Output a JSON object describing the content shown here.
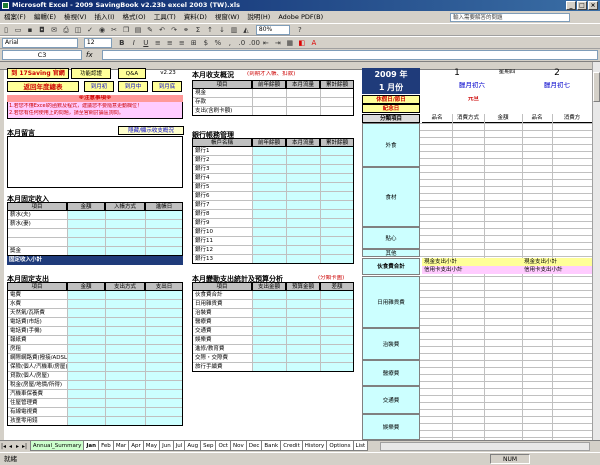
{
  "window": {
    "title": "Microsoft Excel - 2009 SavingBook v2.23b excel 2003 (TW).xls",
    "min": "_",
    "max": "□",
    "close": "×"
  },
  "menu": {
    "items": [
      "檔案(F)",
      "編輯(E)",
      "檢視(V)",
      "插入(I)",
      "格式(O)",
      "工具(T)",
      "資料(D)",
      "視窗(W)",
      "說明(H)",
      "Adobe PDF(B)"
    ],
    "help_placeholder": "輸入需要解答的問題"
  },
  "toolbar": {
    "font_name": "Arial",
    "font_size": "12",
    "zoom": "80%"
  },
  "formula": {
    "name_box": "C3",
    "fx": "fx",
    "value": ""
  },
  "sheet": {
    "left": {
      "btn_title": "到 17Saving 官網",
      "btn_fund": "功能認證",
      "btn_qa": "Q&A",
      "version": "v2.23",
      "btn_return": "返回年度總表",
      "btn_prev": "到月初",
      "btn_mid": "到月中",
      "btn_end": "到月底",
      "notice_title": "※注意事項※",
      "notice_1": "1.若您不懂Excel的函數及程式，建議您不要隨意更動欄位！",
      "notice_2": "2.若您有任何使用上的問題，請至官網討論區詢問。",
      "memo_title": "本月留言",
      "toggle_btn": "隱藏/顯示收支概況",
      "fixed_income_title": "本月固定收入",
      "fixed_income_headers": [
        "項目",
        "金額",
        "入帳方式",
        "進帳日"
      ],
      "fixed_income_rows": [
        "薪水(夫)",
        "薪水(妻)",
        "",
        "",
        "獎金"
      ],
      "fixed_income_total": "固定收入小計",
      "fixed_expense_title": "本月固定支出",
      "fixed_expense_headers": [
        "項目",
        "金額",
        "支出方式",
        "支出日"
      ],
      "fixed_expense_rows": [
        "電費",
        "水費",
        "天然氣/瓦斯費",
        "電話費(市話)",
        "電話費(手機)",
        "報紙費",
        "房租",
        "網際網路費(撥接/ADSL)",
        "保險(個人/汽機車/房屋)",
        "貸款(個人/房屋)",
        "稅金(房屋/地價/所得)",
        "汽機車保養費",
        "住屋管理費",
        "有線電視費",
        "孩童零用錢"
      ]
    },
    "middle": {
      "overview_title": "本月收支概況",
      "overview_note": "(到期才入帳、扣款)",
      "overview_headers": [
        "項目",
        "前年餘額",
        "本月流量",
        "累計餘額"
      ],
      "overview_rows": [
        "現金",
        "存款",
        "支出(含刷卡額)"
      ],
      "bank_title": "銀行帳務管理",
      "bank_headers": [
        "帳戶名稱",
        "前年餘額",
        "本月流量",
        "累計餘額"
      ],
      "bank_rows": [
        "銀行1",
        "銀行2",
        "銀行3",
        "銀行4",
        "銀行5",
        "銀行6",
        "銀行7",
        "銀行8",
        "銀行9",
        "銀行10",
        "銀行11",
        "銀行12",
        "銀行13"
      ],
      "variable_title": "本月變動支出統計及預算分析",
      "variable_note": "(分類卡圖)",
      "variable_headers": [
        "項目",
        "支出金額",
        "預算金額",
        "差額"
      ],
      "variable_rows": [
        "伙食費合計",
        "日用雜貨費",
        "治裝費",
        "醫療費",
        "交通費",
        "娛樂費",
        "進修/教育費",
        "交際・交際費",
        "旅行手續費"
      ]
    },
    "right": {
      "year": "2009 年",
      "month": "1 月份",
      "day1_num": "1",
      "day1_weekday": "星期四",
      "day1_lunar": "臘月初六",
      "day2_num": "2",
      "day2_lunar": "臘月初七",
      "holiday_label": "休假日/節日",
      "holiday_value": "元旦",
      "anniversary_label": "紀念日",
      "category_label": "分類項目",
      "day_headers": [
        "品名",
        "消費方式",
        "金額",
        "品名",
        "消費方"
      ],
      "categories": [
        "外食",
        "食材",
        "點心",
        "其他"
      ],
      "food_total": "伙食費合計",
      "cash_subtotal": "現金支出小計",
      "credit_subtotal": "信用卡支出小計",
      "lower_categories": [
        "日用雜貨費",
        "治裝費",
        "醫療費",
        "交通費",
        "娛樂費"
      ]
    }
  },
  "tabs": [
    "Annual_Summary",
    "Jan",
    "Feb",
    "Mar",
    "Apr",
    "May",
    "Jun",
    "Jul",
    "Aug",
    "Sep",
    "Oct",
    "Nov",
    "Dec",
    "Bank",
    "Credit",
    "History",
    "Options",
    "List"
  ],
  "status": {
    "ready": "就緒",
    "num": "NUM"
  }
}
